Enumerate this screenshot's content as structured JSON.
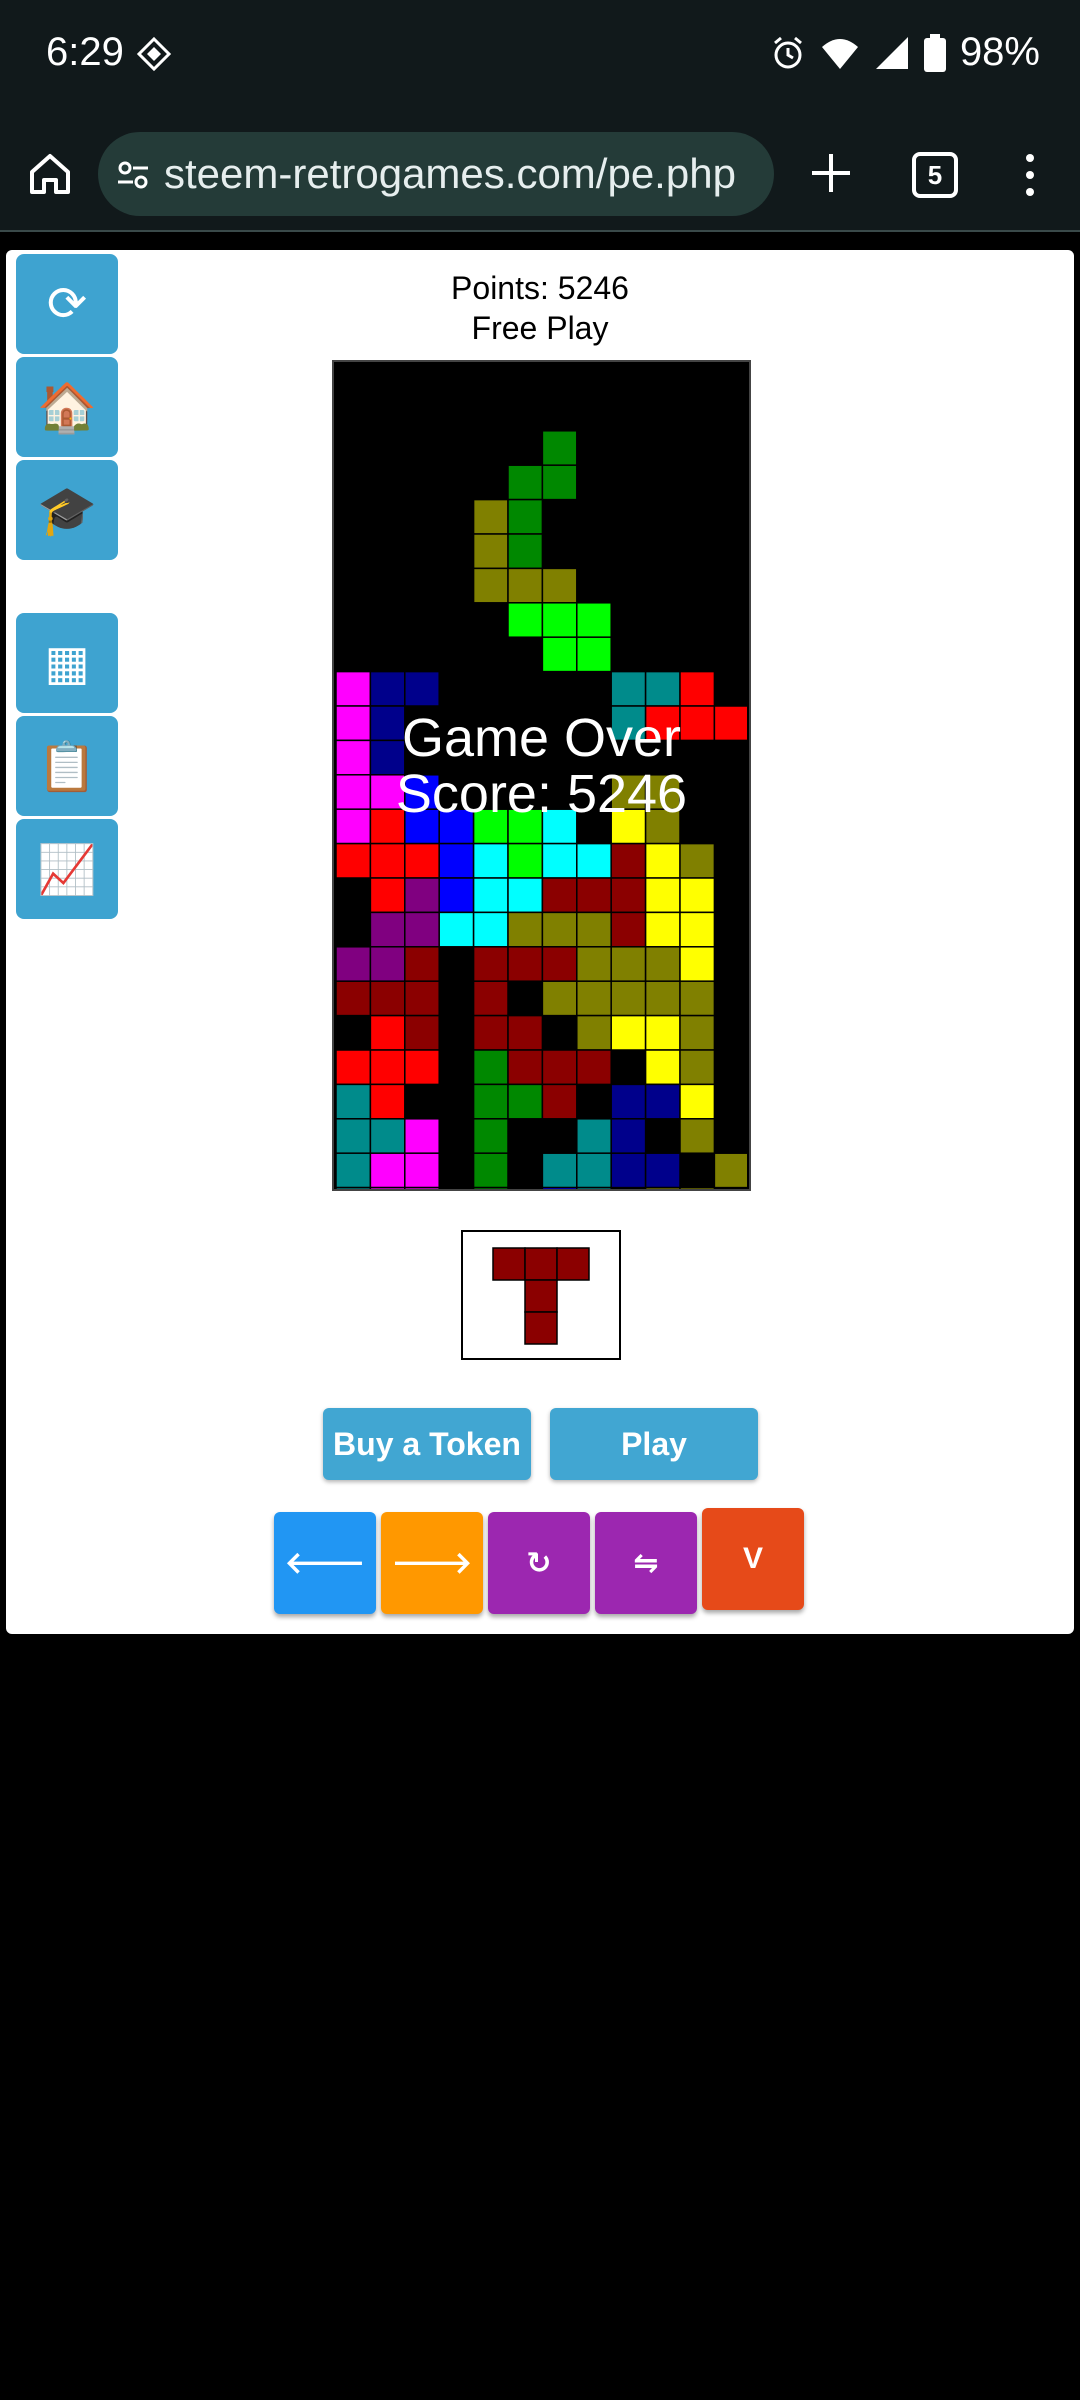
{
  "status_bar": {
    "time": "6:29",
    "battery": "98%",
    "icons": [
      "diamond-icon",
      "alarm-icon",
      "wifi-icon",
      "signal-icon",
      "battery-icon"
    ]
  },
  "browser": {
    "url": "steem-retrogames.com/pe.php",
    "tab_count": "5",
    "icons": [
      "home-icon",
      "site-settings-icon",
      "plus-icon",
      "tabs-icon",
      "menu-icon"
    ]
  },
  "sidebar": {
    "buttons": [
      {
        "name": "refresh",
        "glyph": "⟳"
      },
      {
        "name": "home",
        "glyph": "🏠"
      },
      {
        "name": "tutorial",
        "glyph": "🎓"
      },
      {
        "name": "grid",
        "glyph": "▦"
      },
      {
        "name": "clipboard",
        "glyph": "📋"
      },
      {
        "name": "stats",
        "glyph": "📈"
      }
    ]
  },
  "game": {
    "points_label": "Points: 5246",
    "mode_label": "Free Play",
    "game_over_line1": "Game Over",
    "game_over_line2": "Score: 5246",
    "board_rows": [
      "...........",
      "...........",
      "......G....",
      ".....GG....",
      "....OG.....",
      "....OG.....",
      "....OOO....",
      ".....LLL...",
      "......LL...",
      "MNN.....TTR",
      "MN......TRRR",
      "MN.........",
      "MMB.....OO",
      "MRBBLLC.YO",
      "RRRBCLCCDYO",
      ".RPBCCDDDYY",
      ".PPCCOOODYY",
      "PPD.DDDOOOY",
      "DDD.D.OOOOO",
      ".RD.DD.OYYO",
      "RRR.GDDD.YO",
      "TR..GGD.NNY",
      "TTM.G..TN.O",
      "TMM.G.TTNN.O",
      "TMM.G.BT.OO"
    ],
    "next_piece": "T",
    "next_piece_color": "#8b0000"
  },
  "colors": {
    "G": "#008800",
    "O": "#808000",
    "L": "#00ff00",
    "M": "#ff00ff",
    "N": "#00008b",
    "T": "#008b8b",
    "R": "#ff0000",
    "B": "#0000ff",
    "C": "#00ffff",
    "Y": "#ffff00",
    "D": "#8b0000",
    "P": "#800080"
  },
  "buttons": {
    "buy_token": "Buy a Token",
    "play": "Play"
  },
  "controls": [
    {
      "name": "move-left",
      "glyph": "🡐",
      "color": "#2196f3"
    },
    {
      "name": "move-right",
      "glyph": "🡒",
      "color": "#ff9800"
    },
    {
      "name": "rotate",
      "glyph": "↻",
      "color": "#9c27b0"
    },
    {
      "name": "swap",
      "glyph": "⇋",
      "color": "#9c27b0"
    },
    {
      "name": "drop",
      "glyph": "V",
      "color": "#e64a19"
    }
  ]
}
